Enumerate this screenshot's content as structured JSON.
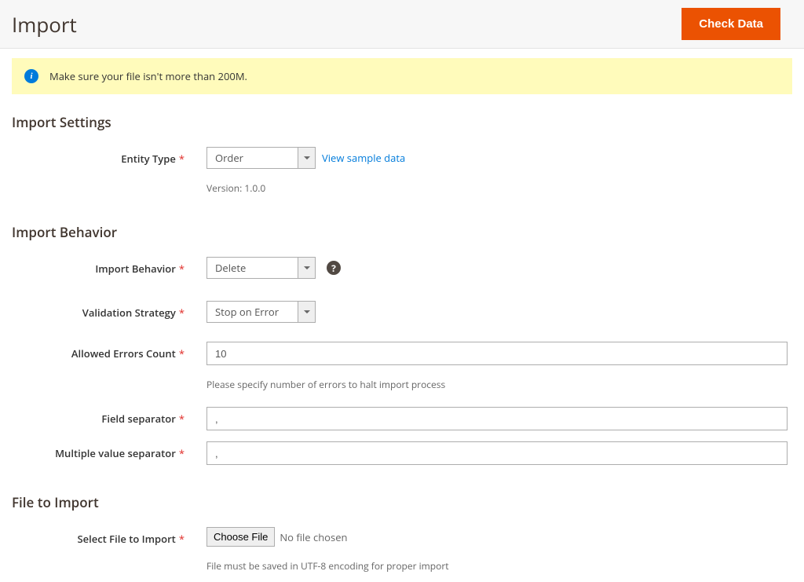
{
  "header": {
    "title": "Import",
    "checkData": "Check Data"
  },
  "notice": {
    "text": "Make sure your file isn't more than 200M."
  },
  "sections": {
    "importSettings": {
      "title": "Import Settings",
      "entityType": {
        "label": "Entity Type",
        "value": "Order",
        "sampleLink": "View sample data",
        "version": "Version: 1.0.0"
      }
    },
    "importBehavior": {
      "title": "Import Behavior",
      "behavior": {
        "label": "Import Behavior",
        "value": "Delete"
      },
      "validation": {
        "label": "Validation Strategy",
        "value": "Stop on Error"
      },
      "errorsCount": {
        "label": "Allowed Errors Count",
        "value": "10",
        "hint": "Please specify number of errors to halt import process"
      },
      "fieldSep": {
        "label": "Field separator",
        "value": ","
      },
      "multiSep": {
        "label": "Multiple value separator",
        "value": ","
      }
    },
    "fileToImport": {
      "title": "File to Import",
      "select": {
        "label": "Select File to Import",
        "button": "Choose File",
        "placeholder": "No file chosen",
        "hint": "File must be saved in UTF-8 encoding for proper import"
      }
    }
  }
}
